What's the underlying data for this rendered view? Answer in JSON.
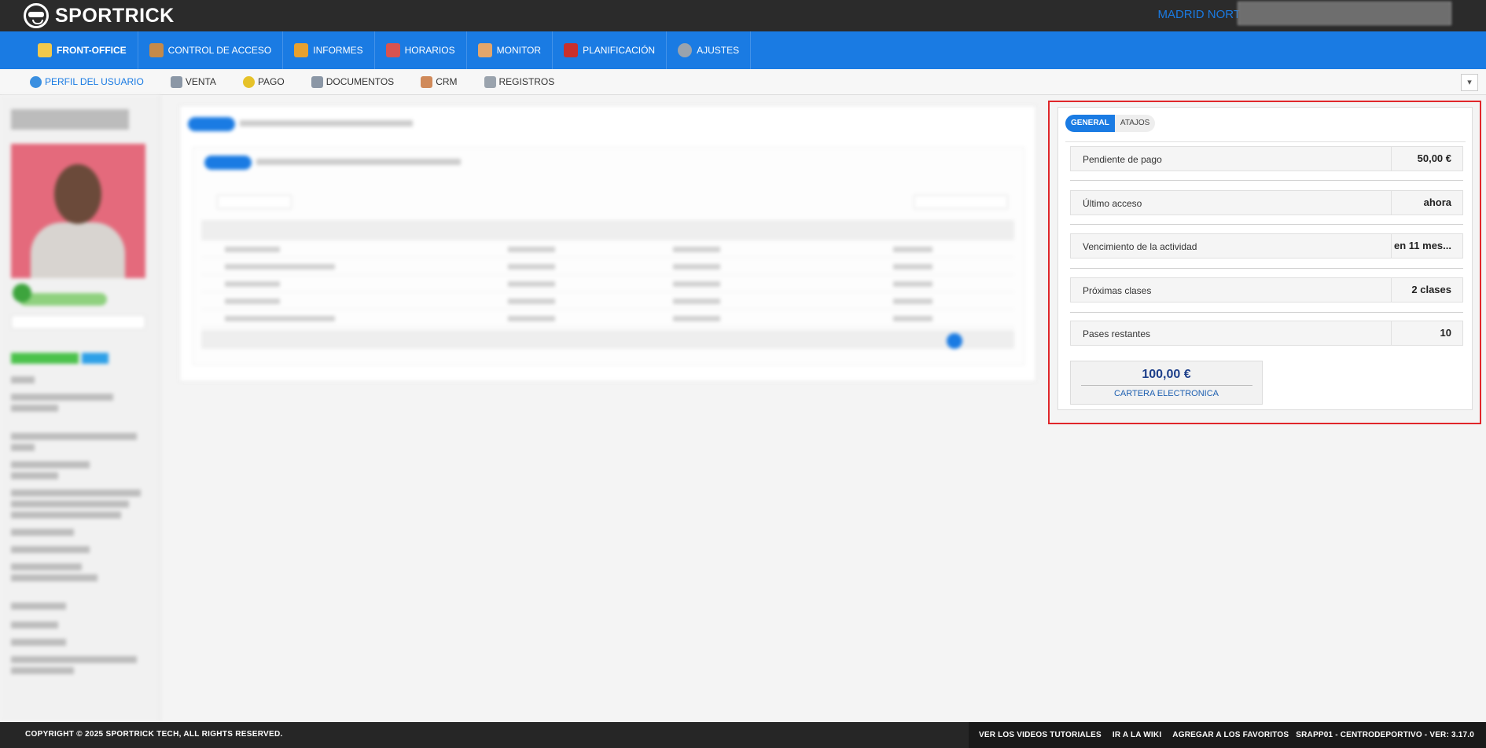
{
  "brand": {
    "name": "SPORTRICK"
  },
  "header": {
    "site": "MADRID NORTE"
  },
  "main_nav": [
    {
      "label": "FRONT-OFFICE",
      "icon": "front-office-icon",
      "color": "#f2c94c"
    },
    {
      "label": "CONTROL DE ACCESO",
      "icon": "access-control-icon",
      "color": "#c58a4a"
    },
    {
      "label": "INFORMES",
      "icon": "reports-icon",
      "color": "#e8a12e"
    },
    {
      "label": "HORARIOS",
      "icon": "calendar-icon",
      "color": "#d9534f"
    },
    {
      "label": "MONITOR",
      "icon": "monitor-icon",
      "color": "#e3a66b"
    },
    {
      "label": "PLANIFICACIÓN",
      "icon": "planning-icon",
      "color": "#c9302c"
    },
    {
      "label": "AJUSTES",
      "icon": "gear-icon",
      "color": "#9aa3ad"
    }
  ],
  "sub_nav": [
    {
      "label": "PERFIL DEL USUARIO",
      "icon": "user-icon",
      "color": "#3a8fe0"
    },
    {
      "label": "VENTA",
      "icon": "sale-icon",
      "color": "#8b97a6"
    },
    {
      "label": "PAGO",
      "icon": "coin-icon",
      "color": "#e6c229"
    },
    {
      "label": "DOCUMENTOS",
      "icon": "document-icon",
      "color": "#8b97a6"
    },
    {
      "label": "CRM",
      "icon": "handshake-icon",
      "color": "#d08a5a"
    },
    {
      "label": "REGISTROS",
      "icon": "log-icon",
      "color": "#9aa3ad"
    }
  ],
  "right_panel": {
    "tabs": [
      "GENERAL",
      "ATAJOS"
    ],
    "rows": [
      {
        "label": "Pendiente de pago",
        "value": "50,00 €"
      },
      {
        "label": "Último acceso",
        "value": "ahora"
      },
      {
        "label": "Vencimiento de la actividad",
        "value": "en 11 mes..."
      },
      {
        "label": "Próximas clases",
        "value": "2 clases"
      },
      {
        "label": "Pases restantes",
        "value": "10"
      }
    ],
    "wallet": {
      "amount": "100,00 €",
      "label": "CARTERA ELECTRONICA"
    }
  },
  "footer": {
    "copyright": "COPYRIGHT © 2025 SPORTRICK TECH, ALL RIGHTS RESERVED.",
    "links": [
      "VER LOS VIDEOS TUTORIALES",
      "IR A LA WIKI",
      "AGREGAR A LOS FAVORITOS"
    ],
    "version": "SRAPP01 - CENTRODEPORTIVO - VER: 3.17.0"
  },
  "colors": {
    "accent": "#1a7be3",
    "topbar": "#2b2b2b",
    "highlight": "#e0262a"
  }
}
